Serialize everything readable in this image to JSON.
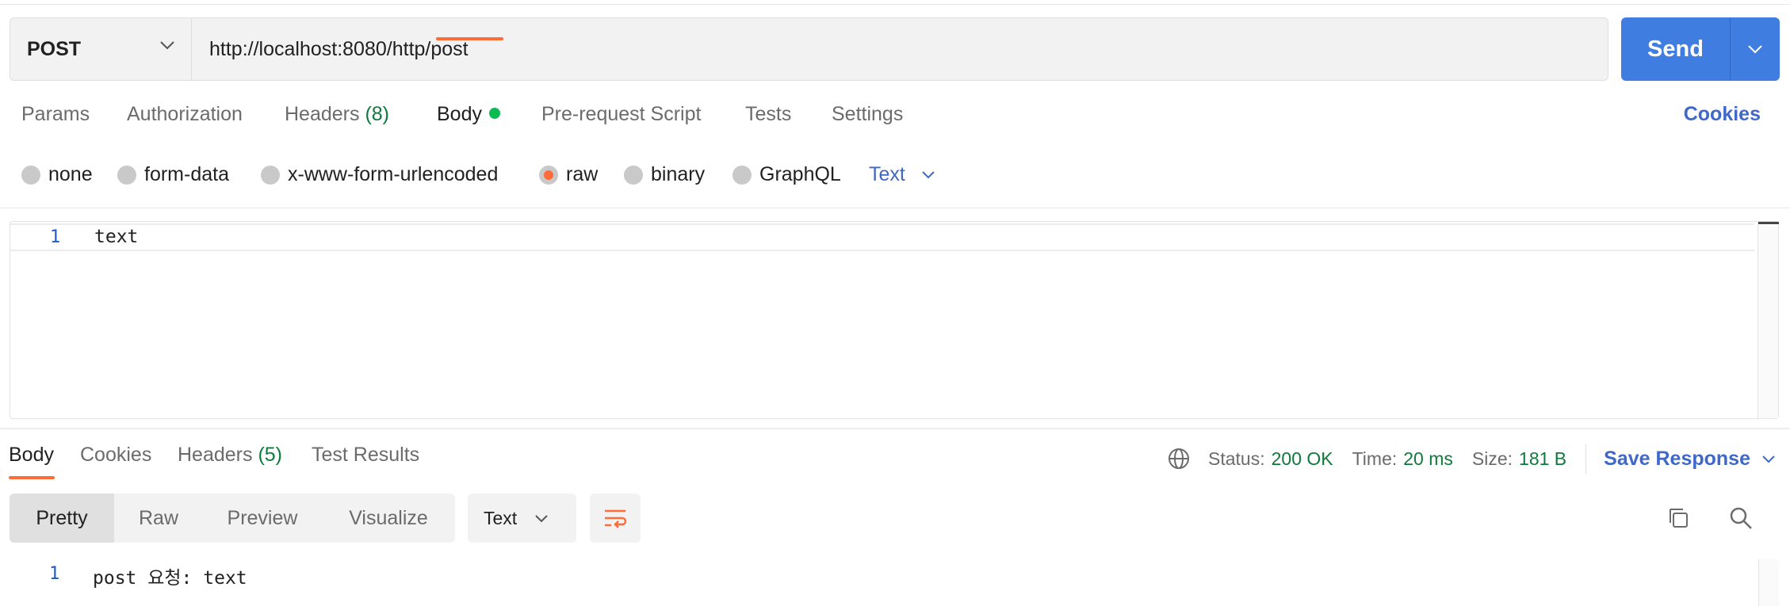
{
  "request": {
    "method": "POST",
    "url": "http://localhost:8080/http/post",
    "send_label": "Send"
  },
  "request_tabs": {
    "params": "Params",
    "authorization": "Authorization",
    "headers": "Headers",
    "headers_count": "(8)",
    "body": "Body",
    "pre_request": "Pre-request Script",
    "tests": "Tests",
    "settings": "Settings",
    "cookies": "Cookies"
  },
  "body_types": {
    "none": "none",
    "form_data": "form-data",
    "urlencoded": "x-www-form-urlencoded",
    "raw": "raw",
    "binary": "binary",
    "graphql": "GraphQL",
    "selected": "raw",
    "language": "Text"
  },
  "editor": {
    "line_number": "1",
    "content": "text"
  },
  "response_tabs": {
    "body": "Body",
    "cookies": "Cookies",
    "headers": "Headers",
    "headers_count": "(5)",
    "test_results": "Test Results"
  },
  "response_status": {
    "status_label": "Status:",
    "status_value": "200 OK",
    "time_label": "Time:",
    "time_value": "20 ms",
    "size_label": "Size:",
    "size_value": "181 B",
    "save_response": "Save Response"
  },
  "response_view": {
    "modes": [
      "Pretty",
      "Raw",
      "Preview",
      "Visualize"
    ],
    "active_mode": "Pretty",
    "format": "Text",
    "line_number": "1",
    "content": "post 요청: text"
  },
  "colors": {
    "accent_orange": "#ff6c37",
    "send_blue": "#3f7de0",
    "link_blue": "#3f68c8",
    "success_green": "#0f7a3b"
  },
  "icons": {
    "method_dropdown": "chevron-down-icon",
    "send_dropdown": "chevron-down-icon",
    "globe": "globe-icon",
    "wrap": "wrap-lines-icon",
    "copy": "copy-icon",
    "search": "search-icon"
  }
}
